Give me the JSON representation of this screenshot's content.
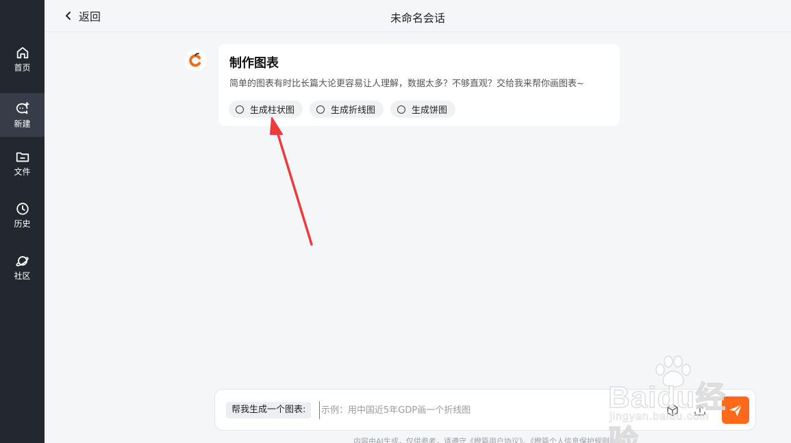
{
  "sidebar": {
    "items": [
      {
        "label": "首页",
        "icon": "home-icon"
      },
      {
        "label": "新建",
        "icon": "new-chat-icon",
        "active": true
      },
      {
        "label": "文件",
        "icon": "folder-icon"
      },
      {
        "label": "历史",
        "icon": "clock-icon"
      },
      {
        "label": "社区",
        "icon": "planet-icon"
      }
    ]
  },
  "header": {
    "back_label": "返回",
    "title": "未命名会话"
  },
  "message": {
    "avatar_icon": "bot-logo-icon",
    "title": "制作图表",
    "description": "简单的图表有时比长篇大论更容易让人理解，数据太多？不够直观？交给我来帮你画图表~",
    "options": [
      {
        "label": "生成柱状图"
      },
      {
        "label": "生成折线图"
      },
      {
        "label": "生成饼图"
      }
    ]
  },
  "input": {
    "prompt_tag": "帮我生成一个图表:",
    "placeholder": "示例：用中国近5年GDP画一个折线图",
    "value": ""
  },
  "footer": {
    "note": "内容由AI生成，仅供参考，请遵守《橙篇用户协议》、《橙篇个人信息保护规则》"
  },
  "watermark": {
    "text": "Baidu经验",
    "sub": "jingyan.baidu.com"
  },
  "colors": {
    "sidebar_bg": "#23272f",
    "sidebar_active": "#363c48",
    "accent": "#ff6a1a",
    "annotation_arrow": "#f03a3a"
  }
}
